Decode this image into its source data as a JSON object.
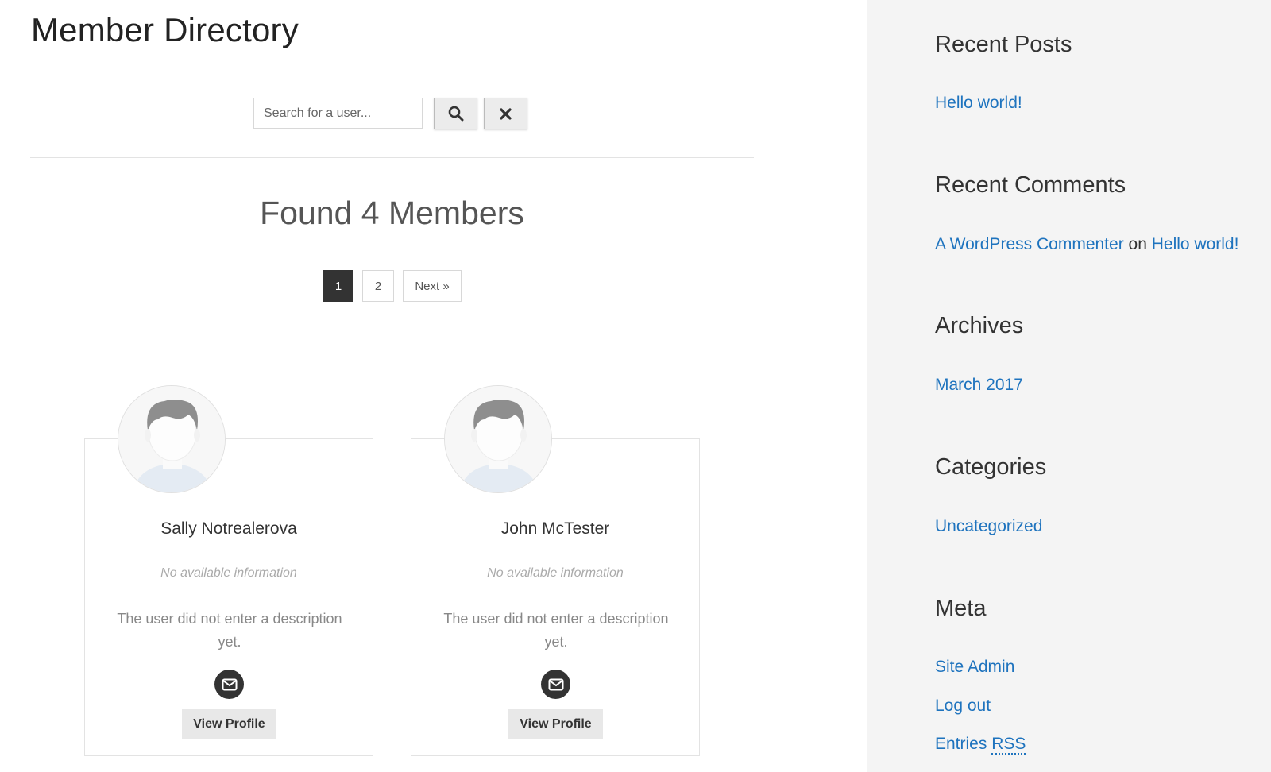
{
  "main": {
    "title": "Member Directory",
    "search": {
      "placeholder": "Search for a user...",
      "value": ""
    },
    "found_text": "Found 4 Members",
    "pagination": {
      "pages": [
        "1",
        "2"
      ],
      "current": "1",
      "next_label": "Next »"
    },
    "members": [
      {
        "name": "Sally Notrealerova",
        "info": "No available information",
        "description": "The user did not enter a description yet.",
        "view_label": "View Profile"
      },
      {
        "name": "John McTester",
        "info": "No available information",
        "description": "The user did not enter a description yet.",
        "view_label": "View Profile"
      }
    ],
    "icons": {
      "search": "search-icon",
      "clear": "close-icon",
      "mail": "envelope-icon",
      "avatar": "default-avatar-icon"
    }
  },
  "sidebar": {
    "recent_posts": {
      "title": "Recent Posts",
      "items": [
        "Hello world!"
      ]
    },
    "recent_comments": {
      "title": "Recent Comments",
      "items": [
        {
          "author": "A WordPress Commenter",
          "connector": "on",
          "post": "Hello world!"
        }
      ]
    },
    "archives": {
      "title": "Archives",
      "items": [
        "March 2017"
      ]
    },
    "categories": {
      "title": "Categories",
      "items": [
        "Uncategorized"
      ]
    },
    "meta": {
      "title": "Meta",
      "site_admin": "Site Admin",
      "log_out": "Log out",
      "entries_prefix": "Entries",
      "entries_abbr": "RSS"
    }
  },
  "colors": {
    "link": "#1e73be",
    "sidebar_bg": "#f4f4f4",
    "active_page": "#333333"
  }
}
